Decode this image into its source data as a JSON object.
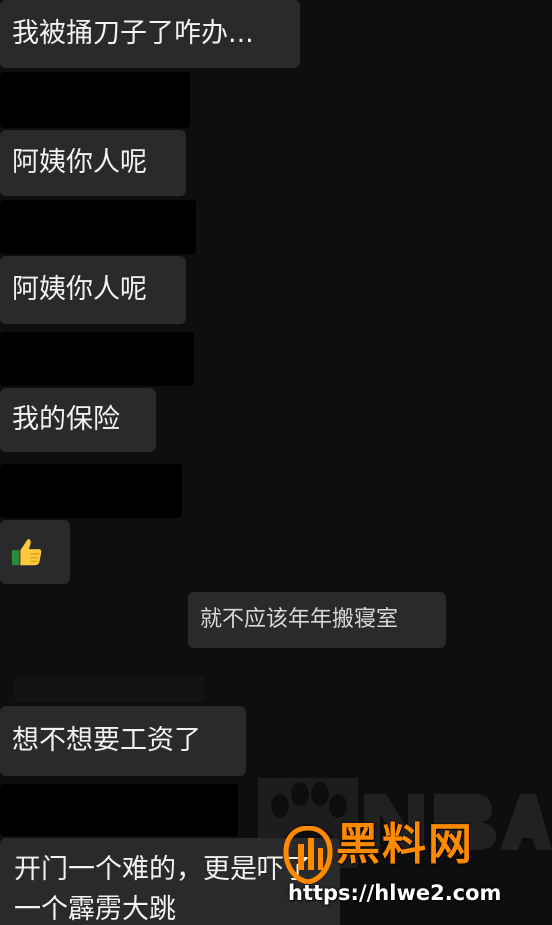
{
  "messages": [
    {
      "text": "我被捅刀子了咋办..."
    },
    {
      "text": "阿姨你人呢"
    },
    {
      "text": "阿姨你人呢"
    },
    {
      "text": "我的保险"
    },
    {
      "text": "",
      "icon": "thumbs-up-icon"
    },
    {
      "text": "就不应该年年搬寝室"
    },
    {
      "text": "想不想要工资了"
    },
    {
      "text": "开门一个难的，更是吓了一个霹雳大跳"
    }
  ],
  "watermark": {
    "title": "黑料网",
    "url": "https://hlwe2.com",
    "accent": "#ff8a00"
  },
  "colors": {
    "background": "#0e0e0f",
    "bubble": "#2a2a2c",
    "text": "#f2f2f2"
  }
}
